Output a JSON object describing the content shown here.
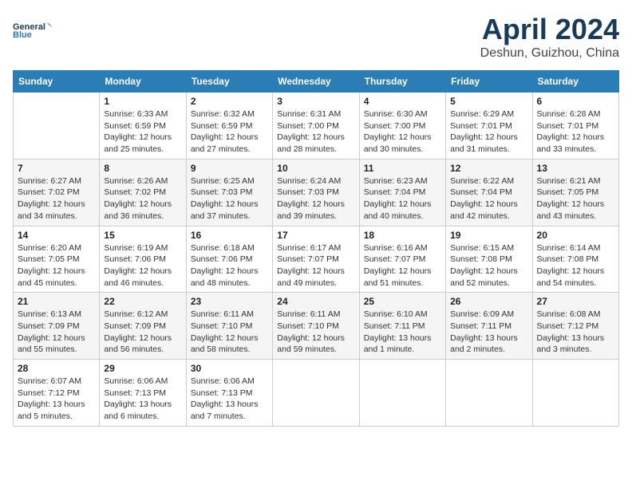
{
  "header": {
    "logo_line1": "General",
    "logo_line2": "Blue",
    "month_title": "April 2024",
    "location": "Deshun, Guizhou, China"
  },
  "weekdays": [
    "Sunday",
    "Monday",
    "Tuesday",
    "Wednesday",
    "Thursday",
    "Friday",
    "Saturday"
  ],
  "weeks": [
    [
      {
        "day": "",
        "info": ""
      },
      {
        "day": "1",
        "info": "Sunrise: 6:33 AM\nSunset: 6:59 PM\nDaylight: 12 hours\nand 25 minutes."
      },
      {
        "day": "2",
        "info": "Sunrise: 6:32 AM\nSunset: 6:59 PM\nDaylight: 12 hours\nand 27 minutes."
      },
      {
        "day": "3",
        "info": "Sunrise: 6:31 AM\nSunset: 7:00 PM\nDaylight: 12 hours\nand 28 minutes."
      },
      {
        "day": "4",
        "info": "Sunrise: 6:30 AM\nSunset: 7:00 PM\nDaylight: 12 hours\nand 30 minutes."
      },
      {
        "day": "5",
        "info": "Sunrise: 6:29 AM\nSunset: 7:01 PM\nDaylight: 12 hours\nand 31 minutes."
      },
      {
        "day": "6",
        "info": "Sunrise: 6:28 AM\nSunset: 7:01 PM\nDaylight: 12 hours\nand 33 minutes."
      }
    ],
    [
      {
        "day": "7",
        "info": "Sunrise: 6:27 AM\nSunset: 7:02 PM\nDaylight: 12 hours\nand 34 minutes."
      },
      {
        "day": "8",
        "info": "Sunrise: 6:26 AM\nSunset: 7:02 PM\nDaylight: 12 hours\nand 36 minutes."
      },
      {
        "day": "9",
        "info": "Sunrise: 6:25 AM\nSunset: 7:03 PM\nDaylight: 12 hours\nand 37 minutes."
      },
      {
        "day": "10",
        "info": "Sunrise: 6:24 AM\nSunset: 7:03 PM\nDaylight: 12 hours\nand 39 minutes."
      },
      {
        "day": "11",
        "info": "Sunrise: 6:23 AM\nSunset: 7:04 PM\nDaylight: 12 hours\nand 40 minutes."
      },
      {
        "day": "12",
        "info": "Sunrise: 6:22 AM\nSunset: 7:04 PM\nDaylight: 12 hours\nand 42 minutes."
      },
      {
        "day": "13",
        "info": "Sunrise: 6:21 AM\nSunset: 7:05 PM\nDaylight: 12 hours\nand 43 minutes."
      }
    ],
    [
      {
        "day": "14",
        "info": "Sunrise: 6:20 AM\nSunset: 7:05 PM\nDaylight: 12 hours\nand 45 minutes."
      },
      {
        "day": "15",
        "info": "Sunrise: 6:19 AM\nSunset: 7:06 PM\nDaylight: 12 hours\nand 46 minutes."
      },
      {
        "day": "16",
        "info": "Sunrise: 6:18 AM\nSunset: 7:06 PM\nDaylight: 12 hours\nand 48 minutes."
      },
      {
        "day": "17",
        "info": "Sunrise: 6:17 AM\nSunset: 7:07 PM\nDaylight: 12 hours\nand 49 minutes."
      },
      {
        "day": "18",
        "info": "Sunrise: 6:16 AM\nSunset: 7:07 PM\nDaylight: 12 hours\nand 51 minutes."
      },
      {
        "day": "19",
        "info": "Sunrise: 6:15 AM\nSunset: 7:08 PM\nDaylight: 12 hours\nand 52 minutes."
      },
      {
        "day": "20",
        "info": "Sunrise: 6:14 AM\nSunset: 7:08 PM\nDaylight: 12 hours\nand 54 minutes."
      }
    ],
    [
      {
        "day": "21",
        "info": "Sunrise: 6:13 AM\nSunset: 7:09 PM\nDaylight: 12 hours\nand 55 minutes."
      },
      {
        "day": "22",
        "info": "Sunrise: 6:12 AM\nSunset: 7:09 PM\nDaylight: 12 hours\nand 56 minutes."
      },
      {
        "day": "23",
        "info": "Sunrise: 6:11 AM\nSunset: 7:10 PM\nDaylight: 12 hours\nand 58 minutes."
      },
      {
        "day": "24",
        "info": "Sunrise: 6:11 AM\nSunset: 7:10 PM\nDaylight: 12 hours\nand 59 minutes."
      },
      {
        "day": "25",
        "info": "Sunrise: 6:10 AM\nSunset: 7:11 PM\nDaylight: 13 hours\nand 1 minute."
      },
      {
        "day": "26",
        "info": "Sunrise: 6:09 AM\nSunset: 7:11 PM\nDaylight: 13 hours\nand 2 minutes."
      },
      {
        "day": "27",
        "info": "Sunrise: 6:08 AM\nSunset: 7:12 PM\nDaylight: 13 hours\nand 3 minutes."
      }
    ],
    [
      {
        "day": "28",
        "info": "Sunrise: 6:07 AM\nSunset: 7:12 PM\nDaylight: 13 hours\nand 5 minutes."
      },
      {
        "day": "29",
        "info": "Sunrise: 6:06 AM\nSunset: 7:13 PM\nDaylight: 13 hours\nand 6 minutes."
      },
      {
        "day": "30",
        "info": "Sunrise: 6:06 AM\nSunset: 7:13 PM\nDaylight: 13 hours\nand 7 minutes."
      },
      {
        "day": "",
        "info": ""
      },
      {
        "day": "",
        "info": ""
      },
      {
        "day": "",
        "info": ""
      },
      {
        "day": "",
        "info": ""
      }
    ]
  ]
}
